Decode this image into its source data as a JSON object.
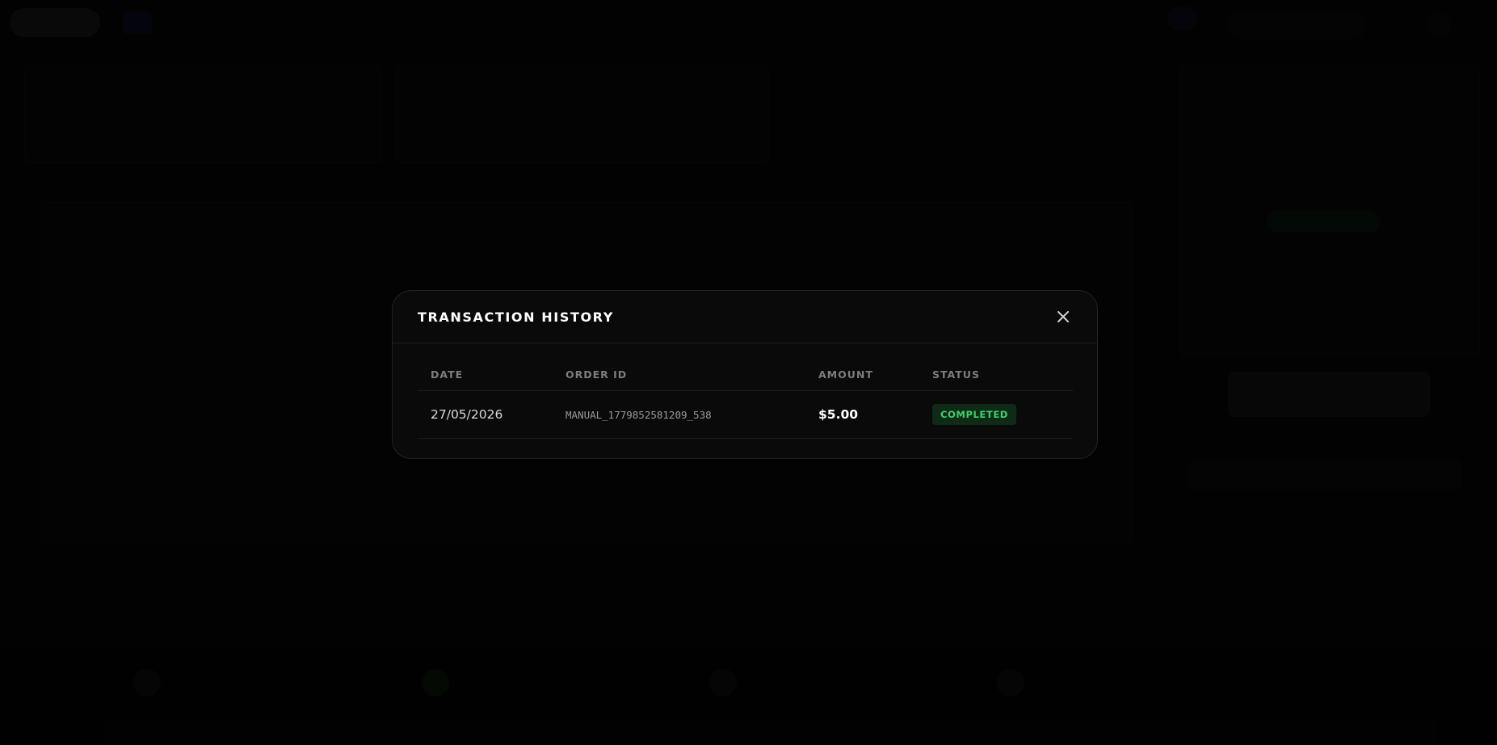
{
  "modal": {
    "title": "TRANSACTION HISTORY",
    "close_icon": "close-icon"
  },
  "table": {
    "columns": [
      "DATE",
      "ORDER ID",
      "AMOUNT",
      "STATUS"
    ],
    "rows": [
      {
        "date": "27/05/2026",
        "order_id": "MANUAL_1779852581209_538",
        "amount": "$5.00",
        "status": "COMPLETED"
      }
    ]
  },
  "colors": {
    "status_completed_text": "#3ad36a",
    "status_completed_bg": "#0f2a17",
    "modal_bg": "#0a0a0a",
    "overlay": "#000000"
  }
}
